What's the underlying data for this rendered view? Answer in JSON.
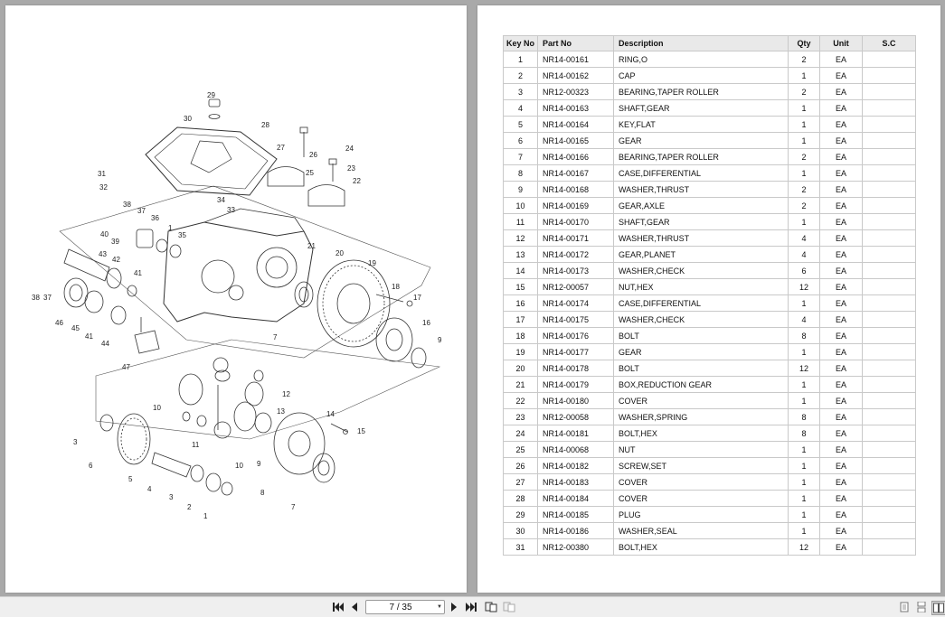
{
  "diagram": {
    "callouts": [
      "1",
      "2",
      "3",
      "4",
      "5",
      "6",
      "7",
      "8",
      "9",
      "10",
      "11",
      "12",
      "13",
      "14",
      "15",
      "16",
      "17",
      "18",
      "19",
      "20",
      "21",
      "22",
      "23",
      "24",
      "25",
      "26",
      "27",
      "28",
      "29",
      "30",
      "31",
      "32",
      "33",
      "34",
      "35",
      "36",
      "37",
      "38",
      "39",
      "40",
      "41",
      "42",
      "43",
      "44",
      "45",
      "46",
      "47"
    ]
  },
  "table": {
    "headers": {
      "key": "Key No",
      "part": "Part No",
      "desc": "Description",
      "qty": "Qty",
      "unit": "Unit",
      "sc": "S.C"
    },
    "rows": [
      {
        "key": "1",
        "part": "NR14-00161",
        "desc": "RING,O",
        "qty": "2",
        "unit": "EA",
        "sc": ""
      },
      {
        "key": "2",
        "part": "NR14-00162",
        "desc": "CAP",
        "qty": "1",
        "unit": "EA",
        "sc": ""
      },
      {
        "key": "3",
        "part": "NR12-00323",
        "desc": "BEARING,TAPER ROLLER",
        "qty": "2",
        "unit": "EA",
        "sc": ""
      },
      {
        "key": "4",
        "part": "NR14-00163",
        "desc": "SHAFT,GEAR",
        "qty": "1",
        "unit": "EA",
        "sc": ""
      },
      {
        "key": "5",
        "part": "NR14-00164",
        "desc": "KEY,FLAT",
        "qty": "1",
        "unit": "EA",
        "sc": ""
      },
      {
        "key": "6",
        "part": "NR14-00165",
        "desc": "GEAR",
        "qty": "1",
        "unit": "EA",
        "sc": ""
      },
      {
        "key": "7",
        "part": "NR14-00166",
        "desc": "BEARING,TAPER ROLLER",
        "qty": "2",
        "unit": "EA",
        "sc": ""
      },
      {
        "key": "8",
        "part": "NR14-00167",
        "desc": "CASE,DIFFERENTIAL",
        "qty": "1",
        "unit": "EA",
        "sc": ""
      },
      {
        "key": "9",
        "part": "NR14-00168",
        "desc": "WASHER,THRUST",
        "qty": "2",
        "unit": "EA",
        "sc": ""
      },
      {
        "key": "10",
        "part": "NR14-00169",
        "desc": "GEAR,AXLE",
        "qty": "2",
        "unit": "EA",
        "sc": ""
      },
      {
        "key": "11",
        "part": "NR14-00170",
        "desc": "SHAFT,GEAR",
        "qty": "1",
        "unit": "EA",
        "sc": ""
      },
      {
        "key": "12",
        "part": "NR14-00171",
        "desc": "WASHER,THRUST",
        "qty": "4",
        "unit": "EA",
        "sc": ""
      },
      {
        "key": "13",
        "part": "NR14-00172",
        "desc": "GEAR,PLANET",
        "qty": "4",
        "unit": "EA",
        "sc": ""
      },
      {
        "key": "14",
        "part": "NR14-00173",
        "desc": "WASHER,CHECK",
        "qty": "6",
        "unit": "EA",
        "sc": ""
      },
      {
        "key": "15",
        "part": "NR12-00057",
        "desc": "NUT,HEX",
        "qty": "12",
        "unit": "EA",
        "sc": ""
      },
      {
        "key": "16",
        "part": "NR14-00174",
        "desc": "CASE,DIFFERENTIAL",
        "qty": "1",
        "unit": "EA",
        "sc": ""
      },
      {
        "key": "17",
        "part": "NR14-00175",
        "desc": "WASHER,CHECK",
        "qty": "4",
        "unit": "EA",
        "sc": ""
      },
      {
        "key": "18",
        "part": "NR14-00176",
        "desc": "BOLT",
        "qty": "8",
        "unit": "EA",
        "sc": ""
      },
      {
        "key": "19",
        "part": "NR14-00177",
        "desc": "GEAR",
        "qty": "1",
        "unit": "EA",
        "sc": ""
      },
      {
        "key": "20",
        "part": "NR14-00178",
        "desc": "BOLT",
        "qty": "12",
        "unit": "EA",
        "sc": ""
      },
      {
        "key": "21",
        "part": "NR14-00179",
        "desc": "BOX,REDUCTION GEAR",
        "qty": "1",
        "unit": "EA",
        "sc": ""
      },
      {
        "key": "22",
        "part": "NR14-00180",
        "desc": "COVER",
        "qty": "1",
        "unit": "EA",
        "sc": ""
      },
      {
        "key": "23",
        "part": "NR12-00058",
        "desc": "WASHER,SPRING",
        "qty": "8",
        "unit": "EA",
        "sc": ""
      },
      {
        "key": "24",
        "part": "NR14-00181",
        "desc": "BOLT,HEX",
        "qty": "8",
        "unit": "EA",
        "sc": ""
      },
      {
        "key": "25",
        "part": "NR14-00068",
        "desc": "NUT",
        "qty": "1",
        "unit": "EA",
        "sc": ""
      },
      {
        "key": "26",
        "part": "NR14-00182",
        "desc": "SCREW,SET",
        "qty": "1",
        "unit": "EA",
        "sc": ""
      },
      {
        "key": "27",
        "part": "NR14-00183",
        "desc": "COVER",
        "qty": "1",
        "unit": "EA",
        "sc": ""
      },
      {
        "key": "28",
        "part": "NR14-00184",
        "desc": "COVER",
        "qty": "1",
        "unit": "EA",
        "sc": ""
      },
      {
        "key": "29",
        "part": "NR14-00185",
        "desc": "PLUG",
        "qty": "1",
        "unit": "EA",
        "sc": ""
      },
      {
        "key": "30",
        "part": "NR14-00186",
        "desc": "WASHER,SEAL",
        "qty": "1",
        "unit": "EA",
        "sc": ""
      },
      {
        "key": "31",
        "part": "NR12-00380",
        "desc": "BOLT,HEX",
        "qty": "12",
        "unit": "EA",
        "sc": ""
      }
    ]
  },
  "toolbar": {
    "page_indicator": "7 / 35",
    "icons": [
      "first-page-icon",
      "prev-page-icon",
      "next-page-icon",
      "last-page-icon",
      "page-layout-icon",
      "page-layout-alt-icon",
      "single-page-view-icon",
      "continuous-view-icon",
      "facing-view-icon"
    ]
  }
}
